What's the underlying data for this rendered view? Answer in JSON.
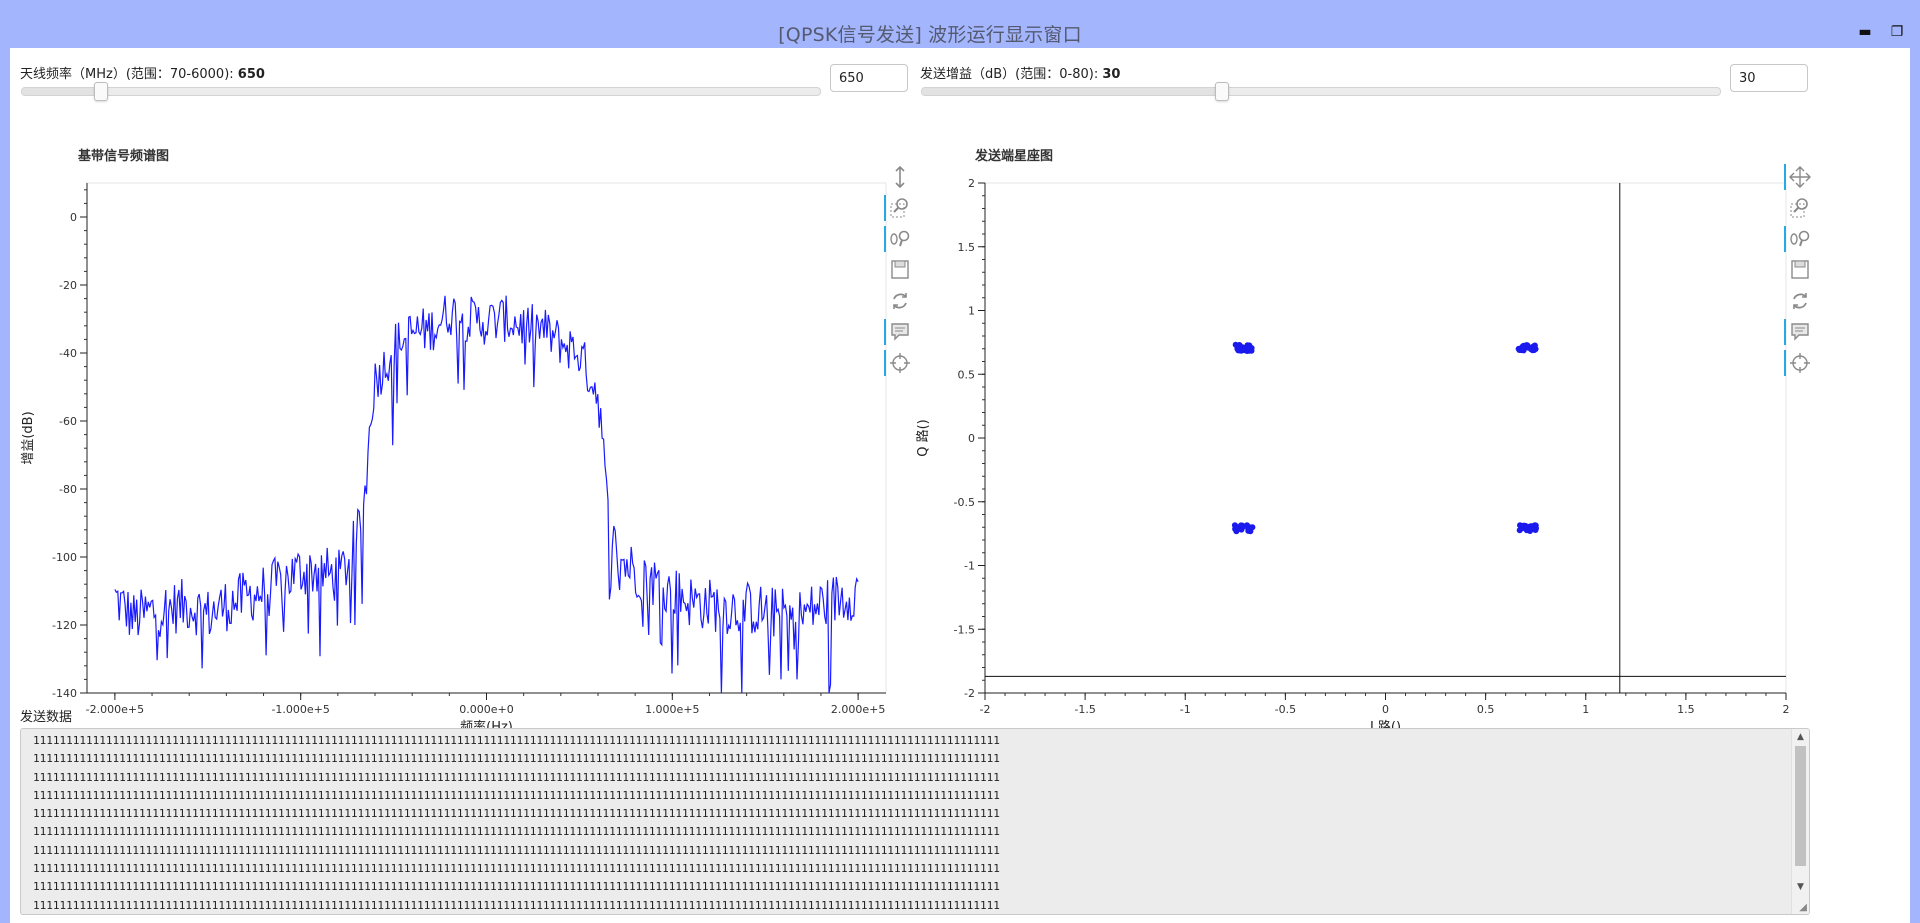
{
  "window": {
    "title": "[QPSK信号发送] 波形运行显示窗口",
    "minimize_glyph": "▬",
    "maximize_glyph": "❐"
  },
  "controls": {
    "frequency": {
      "label": "天线频率（MHz）(范围：70-6000): ",
      "value": "650",
      "min": 70,
      "max": 6000,
      "current": 650
    },
    "gain": {
      "label": "发送增益（dB）(范围：0-80): ",
      "value": "30",
      "min": 0,
      "max": 80,
      "current": 30
    }
  },
  "colors": {
    "line": "#1a1aff",
    "scatter": "#1a1aee",
    "accent": "#26aae1",
    "header": "#a3b5fd"
  },
  "spectrum": {
    "title": "基带信号频谱图",
    "xlabel": "频率(Hz)",
    "ylabel": "增益(dB)",
    "toolbar": [
      {
        "icon": "vertical-pan-icon",
        "active": false
      },
      {
        "icon": "box-zoom-icon",
        "active": true
      },
      {
        "icon": "wheel-zoom-icon",
        "active": true
      },
      {
        "icon": "save-icon",
        "active": false
      },
      {
        "icon": "reset-icon",
        "active": false
      },
      {
        "icon": "hover-icon",
        "active": true
      },
      {
        "icon": "crosshair-icon",
        "active": true
      }
    ]
  },
  "constellation": {
    "title": "发送端星座图",
    "xlabel": "I 路()",
    "ylabel": "Q 路()",
    "toolbar": [
      {
        "icon": "pan-icon",
        "active": true
      },
      {
        "icon": "box-zoom-icon",
        "active": false
      },
      {
        "icon": "wheel-zoom-icon",
        "active": true
      },
      {
        "icon": "save-icon",
        "active": false
      },
      {
        "icon": "reset-icon",
        "active": false
      },
      {
        "icon": "hover-icon",
        "active": true
      },
      {
        "icon": "crosshair-icon",
        "active": true
      }
    ]
  },
  "chart_data": [
    {
      "type": "line",
      "title": "基带信号频谱图",
      "xlabel": "频率(Hz)",
      "ylabel": "增益(dB)",
      "xlim": [
        -215000,
        215000
      ],
      "ylim": [
        -140,
        10
      ],
      "xticks": [
        -200000,
        -100000,
        0,
        100000,
        200000
      ],
      "xtick_labels": [
        "-2.000e+5",
        "-1.000e+5",
        "0.000e+0",
        "1.000e+5",
        "2.000e+5"
      ],
      "yticks": [
        0,
        -20,
        -40,
        -60,
        -80,
        -100,
        -120,
        -140
      ],
      "grid": false,
      "series": [
        {
          "x": [
            -200000,
            -190000,
            -180000,
            -170000,
            -160000,
            -150000,
            -140000,
            -130000,
            -120000,
            -110000,
            -100000,
            -90000,
            -80000,
            -75000,
            -70000,
            -65000,
            -62000,
            -60000,
            -55000,
            -50000,
            -40000,
            -30000,
            -20000,
            -10000,
            0,
            10000,
            20000,
            30000,
            40000,
            50000,
            55000,
            60000,
            62000,
            65000,
            70000,
            75000,
            80000,
            90000,
            100000,
            110000,
            120000,
            130000,
            140000,
            150000,
            160000,
            170000,
            180000,
            190000,
            200000
          ],
          "y": [
            -112,
            -118,
            -116,
            -115,
            -114,
            -117,
            -114,
            -112,
            -110,
            -107,
            -104,
            -104,
            -106,
            -102,
            -95,
            -80,
            -56,
            -48,
            -44,
            -38,
            -34,
            -33,
            -28,
            -30,
            -31,
            -30,
            -32,
            -33,
            -37,
            -40,
            -46,
            -52,
            -62,
            -86,
            -99,
            -102,
            -104,
            -107,
            -110,
            -113,
            -114,
            -115,
            -115,
            -116,
            -117,
            -117,
            -114,
            -112,
            -110
          ]
        }
      ]
    },
    {
      "type": "scatter",
      "title": "发送端星座图",
      "xlabel": "I 路()",
      "ylabel": "Q 路()",
      "xlim": [
        -2,
        2
      ],
      "ylim": [
        -2,
        2
      ],
      "xticks": [
        -2,
        -1.5,
        -1,
        -0.5,
        0,
        0.5,
        1,
        1.5,
        2
      ],
      "yticks": [
        2,
        1.5,
        1,
        0.5,
        0,
        -0.5,
        -1,
        -1.5,
        -2
      ],
      "grid": false,
      "crosshair": {
        "x": 1.17,
        "y": -1.87
      },
      "series": [
        {
          "points": [
            [
              -0.707,
              0.707
            ],
            [
              0.707,
              0.707
            ],
            [
              -0.707,
              -0.707
            ],
            [
              0.707,
              -0.707
            ]
          ]
        }
      ]
    }
  ],
  "data_panel": {
    "label": "发送数据",
    "lines": [
      "11111111111111111111111111111111111111111111111111111111111111111111111111111111111111111111111111111111111111111111111111111111111111111111111111",
      "11111111111111111111111111111111111111111111111111111111111111111111111111111111111111111111111111111111111111111111111111111111111111111111111111",
      "11111111111111111111111111111111111111111111111111111111111111111111111111111111111111111111111111111111111111111111111111111111111111111111111111",
      "11111111111111111111111111111111111111111111111111111111111111111111111111111111111111111111111111111111111111111111111111111111111111111111111111",
      "11111111111111111111111111111111111111111111111111111111111111111111111111111111111111111111111111111111111111111111111111111111111111111111111111",
      "11111111111111111111111111111111111111111111111111111111111111111111111111111111111111111111111111111111111111111111111111111111111111111111111111",
      "11111111111111111111111111111111111111111111111111111111111111111111111111111111111111111111111111111111111111111111111111111111111111111111111111",
      "11111111111111111111111111111111111111111111111111111111111111111111111111111111111111111111111111111111111111111111111111111111111111111111111111",
      "11111111111111111111111111111111111111111111111111111111111111111111111111111111111111111111111111111111111111111111111111111111111111111111111111",
      "11111111111111111111111111111111111111111111111111111111111111111111111111111111111111111111111111111111111111111111111111111111111111111111111111"
    ]
  }
}
